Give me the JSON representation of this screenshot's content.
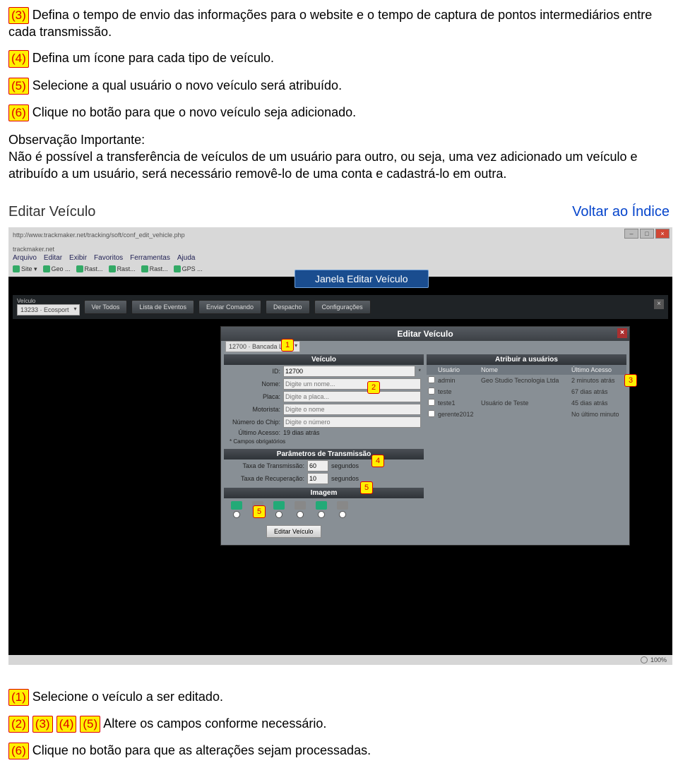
{
  "steps_top": [
    {
      "n": "(3)",
      "text": " Defina o tempo  de envio das informações para o website e o tempo de captura de pontos intermediários entre cada transmissão."
    },
    {
      "n": "(4)",
      "text": " Defina um ícone para cada tipo de veículo."
    },
    {
      "n": "(5)",
      "text": " Selecione a qual usuário o novo veículo será atribuído."
    },
    {
      "n": "(6)",
      "text": " Clique no botão para que o novo veículo seja adicionado."
    }
  ],
  "observation": {
    "title": "Observação Importante:",
    "body": "Não é possível a transferência de veículos de um usuário para outro, ou seja, uma vez adicionado um veículo e atribuído a um usuário, será necessário removê-lo de uma conta e cadastrá-lo em outra."
  },
  "section": {
    "title": "Editar Veículo",
    "back": "Voltar ao Índice"
  },
  "browser": {
    "url": "http://www.trackmaker.net/tracking/soft/conf_edit_vehicle.php",
    "tab": "trackmaker.net",
    "menu": [
      "Arquivo",
      "Editar",
      "Exibir",
      "Favoritos",
      "Ferramentas",
      "Ajuda"
    ],
    "bookmarks": [
      "Site ▾",
      "Geo ...",
      "Rast...",
      "Rast...",
      "Rast...",
      "GPS ..."
    ],
    "zoom": "100%"
  },
  "callout": "Janela Editar Veículo",
  "toolbar": {
    "veic_label": "Veículo",
    "veic_value": "13233 · Ecosport",
    "buttons": [
      "Ver Todos",
      "Lista de Eventos",
      "Enviar Comando",
      "Despacho",
      "Configurações"
    ]
  },
  "dialog": {
    "title": "Editar Veículo",
    "select": "12700 · Bancada Leo",
    "veiculo": {
      "title": "Veículo",
      "fields": [
        {
          "label": "ID:",
          "value": "12700",
          "req": "*"
        },
        {
          "label": "Nome:",
          "value": "Digite um nome..."
        },
        {
          "label": "Placa:",
          "value": "Digite a placa..."
        },
        {
          "label": "Motorista:",
          "value": "Digite o nome"
        },
        {
          "label": "Número do Chip:",
          "value": "Digite o número"
        },
        {
          "label": "Último Acesso:",
          "value": "19 dias atrás"
        }
      ],
      "note": "* Campos obrigatórios"
    },
    "parametros": {
      "title": "Parâmetros de Transmissão",
      "tx_label": "Taxa de Transmissão:",
      "tx_val": "60",
      "tx_unit": "segundos",
      "rx_label": "Taxa de Recuperação:",
      "rx_val": "10",
      "rx_unit": "segundos"
    },
    "imagem": {
      "title": "Imagem"
    },
    "atribuir": {
      "title": "Atribuir a usuários",
      "cols": [
        "",
        "Usuário",
        "Nome",
        "Último Acesso"
      ],
      "rows": [
        {
          "user": "admin",
          "nome": "Geo Studio Tecnologia Ltda",
          "acesso": "2 minutos atrás"
        },
        {
          "user": "teste",
          "nome": "",
          "acesso": "67 dias atrás"
        },
        {
          "user": "teste1",
          "nome": "Usuário de Teste",
          "acesso": "45 dias atrás"
        },
        {
          "user": "gerente2012",
          "nome": "",
          "acesso": "No último minuto"
        }
      ]
    },
    "button": "Editar Veículo"
  },
  "markers": {
    "m1": "1",
    "m2": "2",
    "m3": "3",
    "m4": "4",
    "m5a": "5",
    "m5b": "5"
  },
  "steps_bottom": [
    {
      "nums": [
        "(1)"
      ],
      "text": " Selecione o veículo a ser editado."
    },
    {
      "nums": [
        "(2)",
        "(3)",
        "(4)",
        "(5)"
      ],
      "text": " Altere os campos conforme necessário."
    },
    {
      "nums": [
        "(6)"
      ],
      "text": " Clique no botão para que as alterações sejam processadas."
    }
  ]
}
